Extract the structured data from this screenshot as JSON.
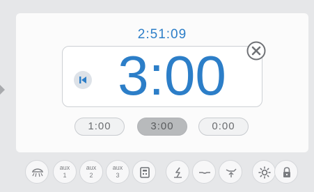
{
  "elapsed_time": "2:51:09",
  "timer": {
    "value": "3:00"
  },
  "presets": [
    {
      "label": "1:00",
      "selected": false
    },
    {
      "label": "3:00",
      "selected": true
    },
    {
      "label": "0:00",
      "selected": false
    }
  ],
  "toolbar": {
    "aux1": {
      "label": "aux",
      "num": "1"
    },
    "aux2": {
      "label": "aux",
      "num": "2"
    },
    "aux3": {
      "label": "aux",
      "num": "3"
    },
    "icons": [
      "lamp-icon",
      "aux-1-button",
      "aux-2-button",
      "aux-3-button",
      "calculator-icon",
      "power-icon",
      "recline-icon",
      "chair-raise-icon",
      "brightness-icon",
      "lock-icon"
    ]
  },
  "colors": {
    "accent": "#2c7ec8",
    "panel": "#fbfbfb",
    "background": "#e6e7e9",
    "preset_selected": "#b8babc"
  }
}
